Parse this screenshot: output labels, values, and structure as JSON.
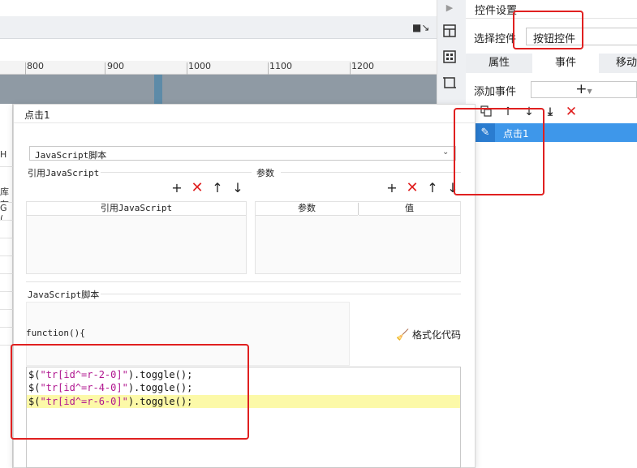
{
  "editor": {
    "ruler_ticks": [
      "800",
      "900",
      "1000",
      "1100",
      "1200"
    ],
    "left_strip_cells": [
      "H",
      "库存",
      "G ("
    ]
  },
  "right_panel": {
    "title": "控件设置",
    "select_label": "选择控件",
    "select_value": "按钮控件",
    "tabs": [
      "属性",
      "事件",
      "移动"
    ],
    "active_tab": "事件",
    "add_event_label": "添加事件",
    "add_event_button": "+",
    "events": [
      "点击1"
    ]
  },
  "dialog": {
    "title": "点击1",
    "type_value": "JavaScript脚本",
    "ref_js_label": "引用JavaScript",
    "params_label": "参数",
    "ref_js_column": "引用JavaScript",
    "params_columns": [
      "参数",
      "值"
    ],
    "script_section_label": "JavaScript脚本",
    "function_header": "function(){",
    "format_code_label": "格式化代码",
    "code_lines": [
      {
        "fn": "$(",
        "str": "\"tr[id^=r-2-0]\"",
        "tail": ").toggle();"
      },
      {
        "fn": "$(",
        "str": "\"tr[id^=r-4-0]\"",
        "tail": ").toggle();"
      },
      {
        "fn": "$(",
        "str": "\"tr[id^=r-6-0]\"",
        "tail": ").toggle();"
      }
    ]
  },
  "colors": {
    "annotation_red": "#e02020",
    "selection_blue": "#3e97ea",
    "highlight_yellow": "#fcf9a8",
    "string_magenta": "#b0158f",
    "delete_red": "#e02020"
  }
}
